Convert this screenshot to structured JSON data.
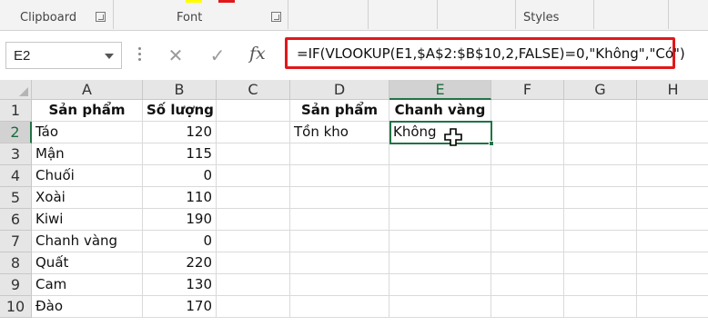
{
  "ribbon": {
    "groups": [
      "Clipboard",
      "Font",
      "Styles"
    ]
  },
  "formula_bar": {
    "name_box": "E2",
    "cancel_symbol": "✕",
    "enter_symbol": "✓",
    "fx_label": "fx",
    "formula": "=IF(VLOOKUP(E1,$A$2:$B$10,2,FALSE)=0,\"Không\",\"Có\")",
    "highlight_color": "#e0181b"
  },
  "grid": {
    "columns": [
      "A",
      "B",
      "C",
      "D",
      "E",
      "F",
      "G",
      "H"
    ],
    "selected_column": "E",
    "rows": [
      "1",
      "2",
      "3",
      "4",
      "5",
      "6",
      "7",
      "8",
      "9",
      "10"
    ],
    "selected_row": "2",
    "cells": {
      "A1": "Sản phẩm",
      "B1": "Số lượng",
      "D1": "Sản phẩm",
      "E1": "Chanh vàng",
      "A2": "Táo",
      "B2": "120",
      "D2": "Tồn kho",
      "E2": "Không",
      "A3": "Mận",
      "B3": "115",
      "A4": "Chuối",
      "B4": "0",
      "A5": "Xoài",
      "B5": "110",
      "A6": "Kiwi",
      "B6": "190",
      "A7": "Chanh vàng",
      "B7": "0",
      "A8": "Quất",
      "B8": "220",
      "A9": "Cam",
      "B9": "130",
      "A10": "Đào",
      "B10": "170"
    },
    "accent_color": "#217346"
  }
}
